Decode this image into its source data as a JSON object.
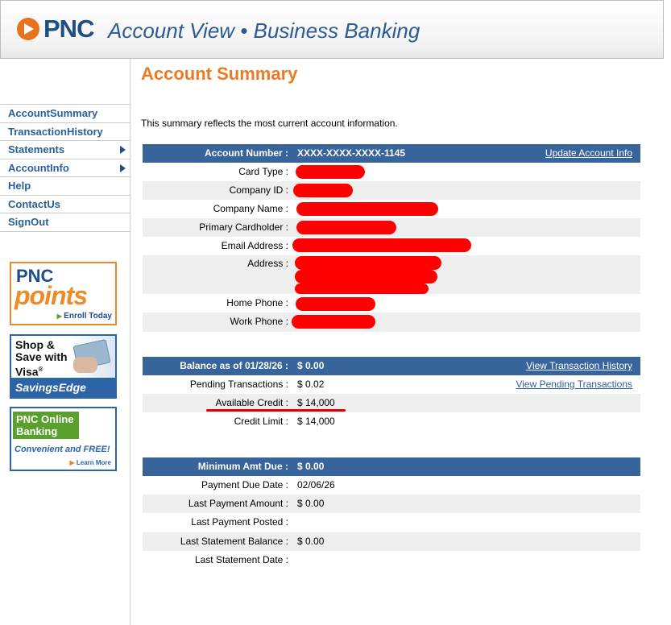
{
  "header": {
    "logo_text": "PNC",
    "app_title": "Account View • Business Banking"
  },
  "nav": {
    "items": [
      {
        "label": "AccountSummary",
        "has_submenu": false
      },
      {
        "label": "TransactionHistory",
        "has_submenu": false
      },
      {
        "label": "Statements",
        "has_submenu": true
      },
      {
        "label": "AccountInfo",
        "has_submenu": true
      },
      {
        "label": "Help",
        "has_submenu": false
      },
      {
        "label": "ContactUs",
        "has_submenu": false
      },
      {
        "label": "SignOut",
        "has_submenu": false
      }
    ]
  },
  "promos": {
    "points": {
      "brand": "PNC",
      "name": "points",
      "cta": "Enroll Today"
    },
    "visa": {
      "line1": "Shop &",
      "line2": "Save with",
      "line3": "Visa",
      "mark": "®",
      "band": "SavingsEdge"
    },
    "online": {
      "line1": "PNC Online",
      "line2": "Banking",
      "tagline": "Convenient and FREE!",
      "cta": "Learn More"
    }
  },
  "main": {
    "title": "Account Summary",
    "intro": "This summary reflects the most current account information.",
    "account": {
      "header_label": "Account Number :",
      "header_value": "XXXX-XXXX-XXXX-1145",
      "header_link": "Update Account Info",
      "rows": [
        {
          "label": "Card Type :"
        },
        {
          "label": "Company ID :"
        },
        {
          "label": "Company Name :"
        },
        {
          "label": "Primary Cardholder :"
        },
        {
          "label": "Email Address :"
        },
        {
          "label": "Address :"
        },
        {
          "label": "Home Phone :"
        },
        {
          "label": "Work Phone :"
        }
      ]
    },
    "balance": {
      "header_label": "Balance as of 01/28/26 :",
      "header_value": "$ 0.00",
      "header_link": "View Transaction History",
      "rows": [
        {
          "label": "Pending Transactions :",
          "value": "$ 0.02",
          "link": "View Pending Transactions"
        },
        {
          "label": "Available Credit :",
          "value": "$ 14,000"
        },
        {
          "label": "Credit Limit :",
          "value": "$ 14,000"
        }
      ]
    },
    "payment": {
      "header_label": "Minimum Amt Due :",
      "header_value": "$ 0.00",
      "rows": [
        {
          "label": "Payment Due Date :",
          "value": "02/06/26"
        },
        {
          "label": "Last Payment Amount :",
          "value": "$ 0.00"
        },
        {
          "label": "Last Payment Posted :",
          "value": ""
        },
        {
          "label": "Last Statement Balance :",
          "value": "$ 0.00"
        },
        {
          "label": "Last Statement Date :",
          "value": ""
        }
      ]
    }
  },
  "colors": {
    "brand_blue": "#36649b",
    "brand_orange": "#ec7a22",
    "redaction": "#ff0000"
  }
}
